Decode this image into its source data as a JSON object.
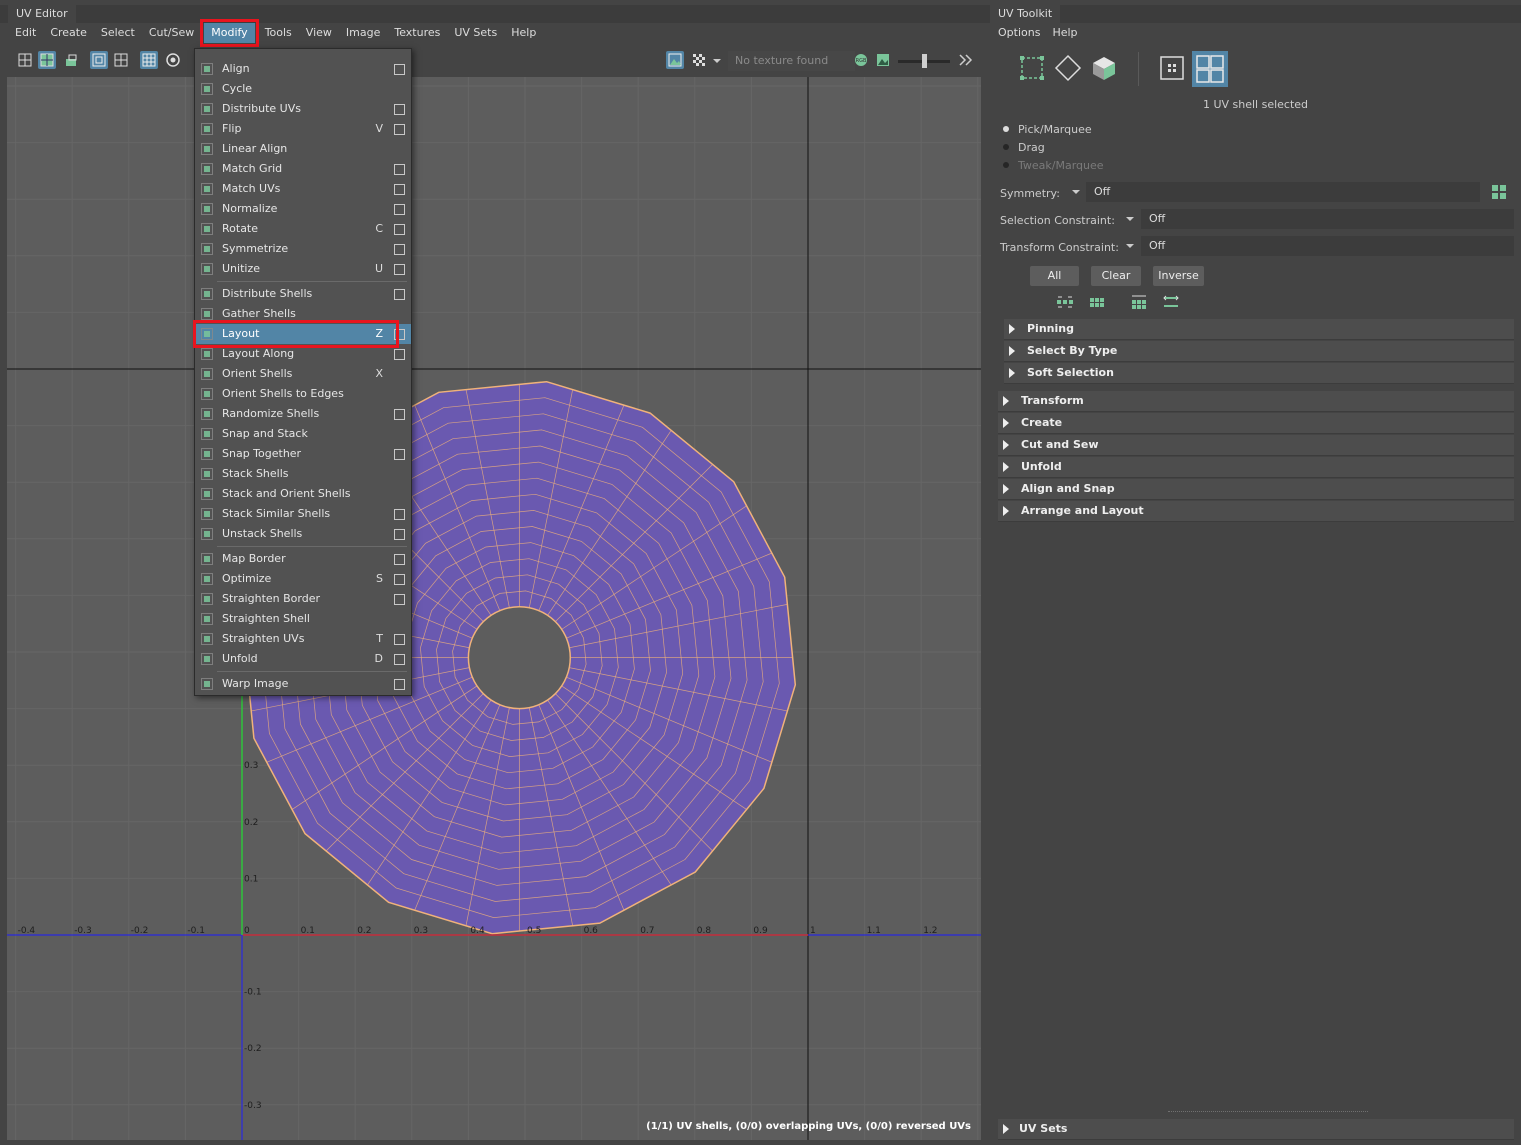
{
  "uv_editor": {
    "title": "UV Editor",
    "menus": [
      "Edit",
      "Create",
      "Select",
      "Cut/Sew",
      "Modify",
      "Tools",
      "View",
      "Image",
      "Textures",
      "UV Sets",
      "Help"
    ],
    "active_menu": "Modify",
    "texture_field": "No texture found",
    "status": "(1/1) UV shells, (0/0) overlapping UVs, (0/0) reversed UVs",
    "axis_x_labels": [
      "-0.4",
      "-0.3",
      "-0.2",
      "-0.1",
      "0",
      "0.1",
      "0.2",
      "0.3",
      "0.4",
      "0.5",
      "0.6",
      "0.7",
      "0.8",
      "0.9",
      "1",
      "1.1",
      "1.2"
    ],
    "axis_y_labels": [
      "0.3",
      "0.2",
      "0.1",
      "-0.1",
      "-0.2",
      "-0.3"
    ]
  },
  "modify_menu": {
    "groups": [
      [
        {
          "label": "Align",
          "shortcut": "",
          "option_box": true,
          "icon": "align-icon"
        },
        {
          "label": "Cycle",
          "shortcut": "",
          "option_box": false,
          "icon": "cycle-icon"
        },
        {
          "label": "Distribute UVs",
          "shortcut": "",
          "option_box": true,
          "icon": "distribute-uvs-icon"
        },
        {
          "label": "Flip",
          "shortcut": "V",
          "option_box": true,
          "icon": "flip-icon"
        },
        {
          "label": "Linear Align",
          "shortcut": "",
          "option_box": false,
          "icon": "linear-align-icon"
        },
        {
          "label": "Match Grid",
          "shortcut": "",
          "option_box": true,
          "icon": "match-grid-icon"
        },
        {
          "label": "Match UVs",
          "shortcut": "",
          "option_box": true,
          "icon": "match-uvs-icon"
        },
        {
          "label": "Normalize",
          "shortcut": "",
          "option_box": true,
          "icon": "normalize-icon"
        },
        {
          "label": "Rotate",
          "shortcut": "C",
          "option_box": true,
          "icon": "rotate-icon"
        },
        {
          "label": "Symmetrize",
          "shortcut": "",
          "option_box": true,
          "icon": "symmetrize-icon"
        },
        {
          "label": "Unitize",
          "shortcut": "U",
          "option_box": true,
          "icon": "unitize-icon"
        }
      ],
      [
        {
          "label": "Distribute Shells",
          "shortcut": "",
          "option_box": true,
          "icon": "distribute-shells-icon"
        },
        {
          "label": "Gather Shells",
          "shortcut": "",
          "option_box": false,
          "icon": "gather-shells-icon"
        },
        {
          "label": "Layout",
          "shortcut": "Z",
          "option_box": true,
          "icon": "layout-icon",
          "highlighted": true
        },
        {
          "label": "Layout Along",
          "shortcut": "",
          "option_box": true,
          "icon": "layout-along-icon"
        },
        {
          "label": "Orient Shells",
          "shortcut": "X",
          "option_box": false,
          "icon": "orient-shells-icon"
        },
        {
          "label": "Orient Shells to Edges",
          "shortcut": "",
          "option_box": false,
          "icon": "orient-shells-to-edges-icon"
        },
        {
          "label": "Randomize Shells",
          "shortcut": "",
          "option_box": true,
          "icon": "randomize-shells-icon"
        },
        {
          "label": "Snap and Stack",
          "shortcut": "",
          "option_box": false,
          "icon": "snap-and-stack-icon"
        },
        {
          "label": "Snap Together",
          "shortcut": "",
          "option_box": true,
          "icon": "snap-together-icon"
        },
        {
          "label": "Stack Shells",
          "shortcut": "",
          "option_box": false,
          "icon": "stack-shells-icon"
        },
        {
          "label": "Stack and Orient Shells",
          "shortcut": "",
          "option_box": false,
          "icon": "stack-and-orient-shells-icon"
        },
        {
          "label": "Stack Similar Shells",
          "shortcut": "",
          "option_box": true,
          "icon": "stack-similar-shells-icon"
        },
        {
          "label": "Unstack Shells",
          "shortcut": "",
          "option_box": true,
          "icon": "unstack-shells-icon"
        }
      ],
      [
        {
          "label": "Map Border",
          "shortcut": "",
          "option_box": true,
          "icon": "map-border-icon"
        },
        {
          "label": "Optimize",
          "shortcut": "S",
          "option_box": true,
          "icon": "optimize-icon"
        },
        {
          "label": "Straighten Border",
          "shortcut": "",
          "option_box": true,
          "icon": "straighten-border-icon"
        },
        {
          "label": "Straighten Shell",
          "shortcut": "",
          "option_box": false,
          "icon": "straighten-shell-icon"
        },
        {
          "label": "Straighten UVs",
          "shortcut": "T",
          "option_box": true,
          "icon": "straighten-uvs-icon"
        },
        {
          "label": "Unfold",
          "shortcut": "D",
          "option_box": true,
          "icon": "unfold-icon"
        }
      ],
      [
        {
          "label": "Warp Image",
          "shortcut": "",
          "option_box": true,
          "icon": "warp-image-icon"
        }
      ]
    ]
  },
  "uv_toolkit": {
    "title": "UV Toolkit",
    "menus": [
      "Options",
      "Help"
    ],
    "selection_status": "1 UV shell selected",
    "tools": [
      {
        "label": "Pick/Marquee",
        "selected": true,
        "enabled": true
      },
      {
        "label": "Drag",
        "selected": false,
        "enabled": true
      },
      {
        "label": "Tweak/Marquee",
        "selected": false,
        "enabled": false
      }
    ],
    "symmetry_label": "Symmetry:",
    "symmetry_value": "Off",
    "selection_constraint_label": "Selection Constraint:",
    "selection_constraint_value": "Off",
    "transform_constraint_label": "Transform Constraint:",
    "transform_constraint_value": "Off",
    "buttons": [
      "All",
      "Clear",
      "Inverse"
    ],
    "subsections": [
      "Pinning",
      "Select By Type",
      "Soft Selection"
    ],
    "sections": [
      "Transform",
      "Create",
      "Cut and Sew",
      "Unfold",
      "Align and Snap",
      "Arrange and Layout"
    ],
    "bottom_section": "UV Sets"
  },
  "colors": {
    "accent": "#5285a6",
    "highlight_box": "#e8141e",
    "uv_shell_fill": "#6a59b0",
    "uv_edges": "#f0b27a",
    "axis_u": "#c83232",
    "axis_v": "#32c832",
    "axis_blue": "#2a2ae0"
  }
}
